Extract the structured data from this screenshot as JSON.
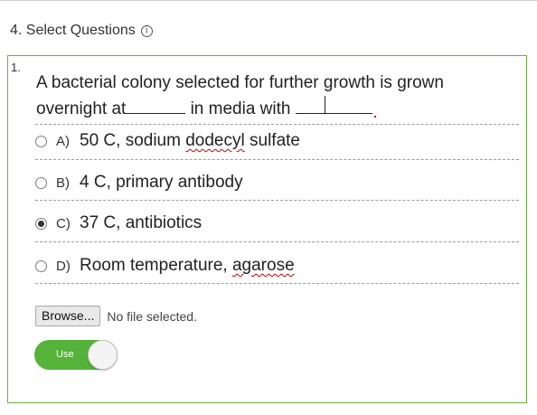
{
  "section": {
    "title": "4. Select Questions",
    "info_icon": "info-circle-icon"
  },
  "question": {
    "number": "1.",
    "text_part1": "A bacterial colony selected for further growth is grown overnight at",
    "text_part2": " in media with ",
    "text_end": ""
  },
  "options": [
    {
      "letter": "A)",
      "pre": "50 C, sodium ",
      "flagged": "dodecyl",
      "post": " sulfate",
      "selected": false
    },
    {
      "letter": "B)",
      "pre": "4 C, primary antibody",
      "flagged": "",
      "post": "",
      "selected": false
    },
    {
      "letter": "C)",
      "pre": "37 C, antibiotics",
      "flagged": "",
      "post": "",
      "selected": true
    },
    {
      "letter": "D)",
      "pre": "Room temperature, ",
      "flagged": "agarose",
      "post": "",
      "selected": false
    }
  ],
  "file": {
    "button_label": "Browse...",
    "status": "No file selected."
  },
  "toggle": {
    "label": "Use",
    "on": true
  },
  "colors": {
    "accent_border": "#6aaf3d",
    "toggle_on": "#55b33a",
    "spellcheck": "#cc0000"
  }
}
